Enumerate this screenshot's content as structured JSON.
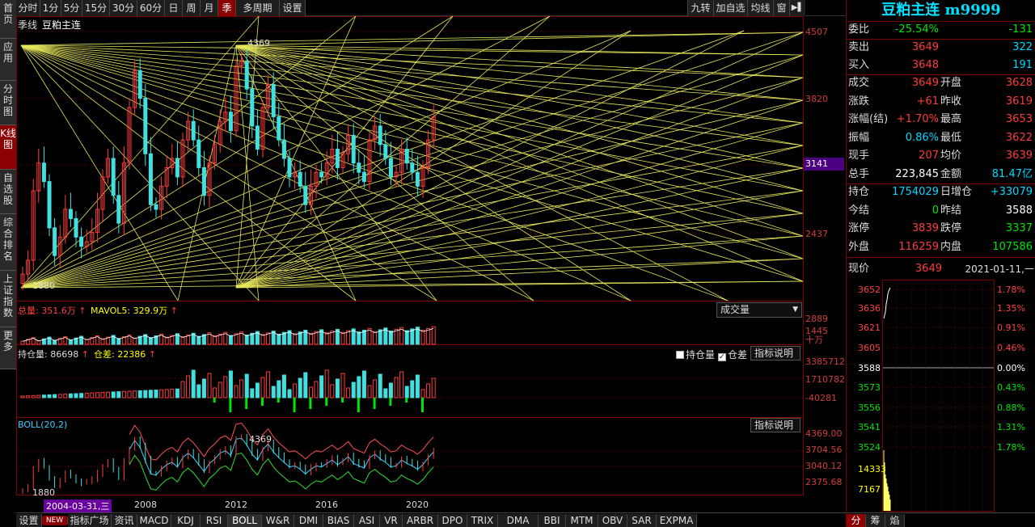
{
  "left_tabs": [
    "首页",
    "应用",
    "分时图",
    "K线图",
    "自选股",
    "综合排名",
    "上证指数",
    "更多"
  ],
  "top_periods": [
    "分时",
    "1分",
    "5分",
    "15分",
    "30分",
    "60分",
    "日",
    "周",
    "月",
    "季",
    "多周期",
    "设置"
  ],
  "top_right": [
    "九转",
    "加自选",
    "均线",
    "窗"
  ],
  "chart": {
    "period_label": "季线",
    "instrument": "豆粕主连",
    "y_axis": [
      "4507",
      "3820",
      "3141",
      "2437"
    ],
    "high_label": "4369",
    "low_label": "1880",
    "x_labels": [
      "2008",
      "2012",
      "2016",
      "2020"
    ],
    "cursor_date": "2004-03-31,三"
  },
  "volume": {
    "label": "总量: 351.6万",
    "ma_label": "MAVOL5: 329.9万",
    "selector": "成交量",
    "y_axis": [
      "2889",
      "1445",
      "十万"
    ]
  },
  "oi": {
    "label": "持仓量: 86698",
    "diff_label": "仓差: 22386",
    "check1": "持仓量",
    "check2": "仓差",
    "help": "指标说明",
    "y_axis": [
      "3385712",
      "1710782",
      "-40281"
    ]
  },
  "boll": {
    "label": "BOLL(20,2)",
    "help": "指标说明",
    "high_label": "4369",
    "low_label": "1880",
    "y_axis": [
      "4369.00",
      "3704.56",
      "3040.12",
      "2375.68"
    ]
  },
  "bottom_tabs": [
    "设置",
    "NEW",
    "指标广场",
    "资讯",
    "MACD",
    "KDJ",
    "RSI",
    "BOLL",
    "W&R",
    "DMI",
    "BIAS",
    "ASI",
    "VR",
    "ARBR",
    "DPO",
    "TRIX",
    "DMA",
    "BBI",
    "MTM",
    "OBV",
    "SAR",
    "EXPMA"
  ],
  "quote": {
    "title": "豆粕主连 m9999",
    "weibi_label": "委比",
    "weibi": "-25.54%",
    "weicha": "-131",
    "sell_label": "卖出",
    "sell_price": "3649",
    "sell_vol": "322",
    "buy_label": "买入",
    "buy_price": "3648",
    "buy_vol": "191",
    "rows": [
      {
        "k1": "成交",
        "v1": "3649",
        "c1": "red",
        "k2": "开盘",
        "v2": "3628",
        "c2": "red"
      },
      {
        "k1": "涨跌",
        "v1": "+61",
        "c1": "red",
        "k2": "昨收",
        "v2": "3619",
        "c2": "red"
      },
      {
        "k1": "涨幅(结)",
        "v1": "+1.70%",
        "c1": "red",
        "k2": "最高",
        "v2": "3653",
        "c2": "red"
      },
      {
        "k1": "振幅",
        "v1": "0.86%",
        "c1": "cyan",
        "k2": "最低",
        "v2": "3622",
        "c2": "red"
      },
      {
        "k1": "现手",
        "v1": "207",
        "c1": "red",
        "k2": "均价",
        "v2": "3639",
        "c2": "red"
      },
      {
        "k1": "总手",
        "v1": "223,845",
        "c1": "white",
        "k2": "金额",
        "v2": "81.47亿",
        "c2": "cyan"
      },
      {
        "k1": "持仓",
        "v1": "1754029",
        "c1": "cyan",
        "k2": "日增仓",
        "v2": "+33079",
        "c2": "cyan"
      },
      {
        "k1": "今结",
        "v1": "0",
        "c1": "green",
        "k2": "昨结",
        "v2": "3588",
        "c2": "white"
      },
      {
        "k1": "涨停",
        "v1": "3839",
        "c1": "red",
        "k2": "跌停",
        "v2": "3337",
        "c2": "green"
      },
      {
        "k1": "外盘",
        "v1": "116259",
        "c1": "red",
        "k2": "内盘",
        "v2": "107586",
        "c2": "green"
      }
    ],
    "now_label": "现价",
    "now_price": "3649",
    "now_date": "2021-01-11,一",
    "mini_left": [
      "3652",
      "3636",
      "3621",
      "3605",
      "3588",
      "3573",
      "3556",
      "3541",
      "3524",
      "14333",
      "7167"
    ],
    "mini_right": [
      "1.78%",
      "1.35%",
      "0.91%",
      "0.46%",
      "0.00%",
      "0.43%",
      "0.88%",
      "1.31%",
      "1.78%"
    ],
    "bottom_tabs": [
      "分",
      "筹",
      "焰"
    ]
  }
}
